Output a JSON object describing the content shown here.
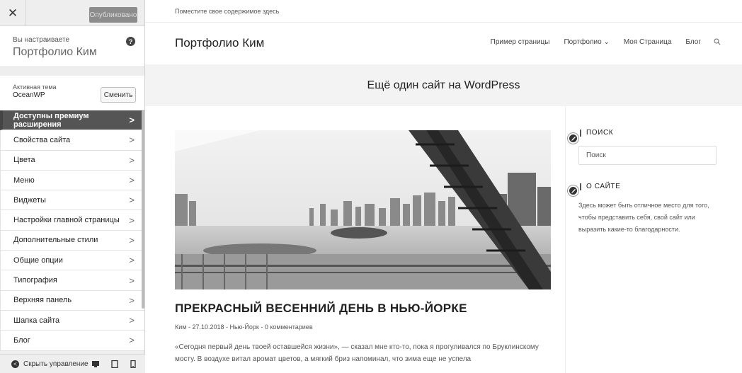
{
  "customizer": {
    "close_icon": "close-icon",
    "publish_label": "Опубликовано",
    "customizing_label": "Вы настраиваете",
    "site_name": "Портфолио Ким",
    "help_icon": "?",
    "theme_label": "Активная тема",
    "theme_name": "OceanWP",
    "change_label": "Сменить",
    "menu": [
      {
        "label": "Доступны премиум расширения",
        "chevron": ">"
      },
      {
        "label": "Свойства сайта",
        "chevron": ">"
      },
      {
        "label": "Цвета",
        "chevron": ">"
      },
      {
        "label": "Меню",
        "chevron": ">"
      },
      {
        "label": "Виджеты",
        "chevron": ">"
      },
      {
        "label": "Настройки главной страницы",
        "chevron": ">"
      },
      {
        "label": "Дополнительные стили",
        "chevron": ">"
      },
      {
        "label": "Общие опции",
        "chevron": ">"
      },
      {
        "label": "Типография",
        "chevron": ">"
      },
      {
        "label": "Верхняя панель",
        "chevron": ">"
      },
      {
        "label": "Шапка сайта",
        "chevron": ">"
      },
      {
        "label": "Блог",
        "chevron": ">"
      }
    ],
    "hide_controls_label": "Скрыть управление",
    "hide_icon": "<"
  },
  "preview": {
    "topbar_text": "Поместите свое содержимое здесь",
    "site_title": "Портфолио Ким",
    "nav": {
      "item1": "Пример страницы",
      "item2": "Портфолио ⌄",
      "item3": "Моя Страница",
      "item4": "Блог"
    },
    "banner_title": "Ещё один сайт на WordPress",
    "post": {
      "title": "ПРЕКРАСНЫЙ ВЕСЕННИЙ ДЕНЬ В НЬЮ-ЙОРКЕ",
      "meta": "Ким - 27.10.2018 - Нью-Йорк - 0 комментариев",
      "text": "«Сегодня первый день твоей оставшейся жизни», — сказал мне кто-то, пока я прогуливался по Бруклинскому мосту. В воздухе витал аромат цветов, а мягкий бриз напоминал, что зима еще не успела"
    },
    "widgets": {
      "search_title": "ПОИСК",
      "search_placeholder": "Поиск",
      "about_title": "О САЙТЕ",
      "about_text": "Здесь может быть отличное место для того, чтобы представить себя, свой сайт или выразить какие-то благодарности."
    }
  }
}
